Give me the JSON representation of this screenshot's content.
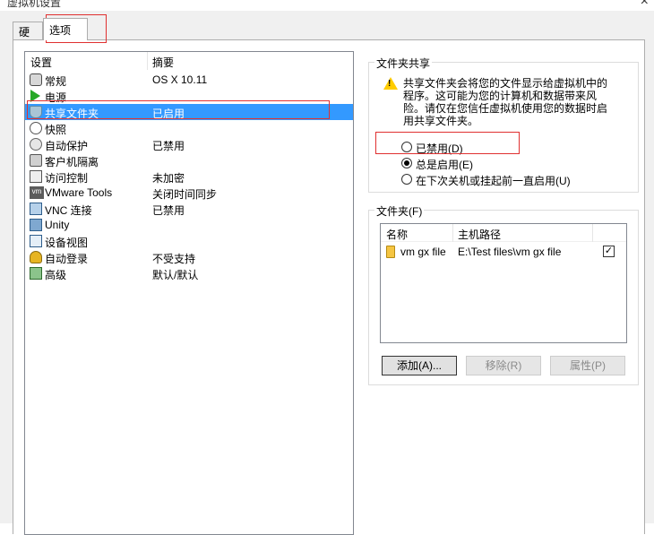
{
  "window": {
    "title": "虚拟机设置",
    "close_glyph": "×"
  },
  "tabs": [
    {
      "label": "硬件",
      "active": false
    },
    {
      "label": "选项",
      "active": true
    }
  ],
  "settings": {
    "col_setting": "设置",
    "col_summary": "摘要",
    "rows": [
      {
        "icon": "general-icon",
        "name": "常规",
        "summary": "OS X 10.11"
      },
      {
        "icon": "power-icon",
        "name": "电源",
        "summary": ""
      },
      {
        "icon": "shared-folders-icon",
        "name": "共享文件夹",
        "summary": "已启用",
        "selected": true
      },
      {
        "icon": "snapshot-icon",
        "name": "快照",
        "summary": ""
      },
      {
        "icon": "autoprotect-icon",
        "name": "自动保护",
        "summary": "已禁用"
      },
      {
        "icon": "guest-isolation-icon",
        "name": "客户机隔离",
        "summary": ""
      },
      {
        "icon": "access-control-icon",
        "name": "访问控制",
        "summary": "未加密"
      },
      {
        "icon": "vmware-tools-icon",
        "name": "VMware Tools",
        "summary": "关闭时间同步",
        "icon_text": "vm"
      },
      {
        "icon": "vnc-icon",
        "name": "VNC 连接",
        "summary": "已禁用"
      },
      {
        "icon": "unity-icon",
        "name": "Unity",
        "summary": ""
      },
      {
        "icon": "device-view-icon",
        "name": "设备视图",
        "summary": ""
      },
      {
        "icon": "autologin-icon",
        "name": "自动登录",
        "summary": "不受支持"
      },
      {
        "icon": "advanced-icon",
        "name": "高级",
        "summary": "默认/默认"
      }
    ]
  },
  "folder_sharing": {
    "group_title": "文件夹共享",
    "warning_icon": "warning-icon",
    "warning_mark": "!",
    "description": "共享文件夹会将您的文件显示给虚拟机中的程序。这可能为您的计算机和数据带来风险。请仅在您信任虚拟机使用您的数据时启用共享文件夹。",
    "options": [
      {
        "label": "已禁用(D)",
        "checked": false
      },
      {
        "label": "总是启用(E)",
        "checked": true
      },
      {
        "label": "在下次关机或挂起前一直启用(U)",
        "checked": false
      }
    ]
  },
  "folders": {
    "group_title": "文件夹(F)",
    "col_name": "名称",
    "col_path": "主机路径",
    "rows": [
      {
        "name": "vm gx file",
        "path": "E:\\Test files\\vm gx file",
        "enabled": true,
        "check_glyph": "✓"
      }
    ],
    "buttons": {
      "add": "添加(A)...",
      "remove": "移除(R)",
      "properties": "属性(P)"
    }
  },
  "colors": {
    "selection": "#3399ff",
    "highlight_box": "#e03030",
    "warning": "#ffcc00"
  }
}
